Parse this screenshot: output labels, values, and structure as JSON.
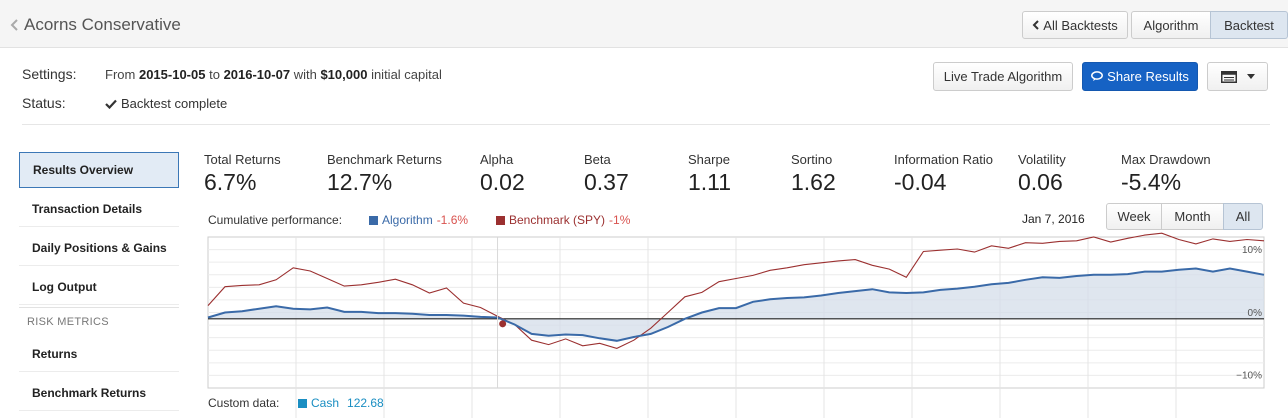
{
  "header": {
    "title": "Acorns Conservative",
    "all_backtests_label": "All Backtests",
    "tab_algorithm": "Algorithm",
    "tab_backtest": "Backtest"
  },
  "settings": {
    "settings_label": "Settings:",
    "from_word": "From",
    "start_date": "2015-10-05",
    "to_word": "to",
    "end_date": "2016-10-07",
    "with_word": "with",
    "capital": "$10,000",
    "capital_suffix": "initial capital",
    "status_label": "Status:",
    "status_value": "Backtest complete"
  },
  "actions": {
    "live_trade_label": "Live Trade Algorithm",
    "share_label": "Share Results"
  },
  "sidebar": {
    "items": [
      {
        "label": "Results Overview"
      },
      {
        "label": "Transaction Details"
      },
      {
        "label": "Daily Positions & Gains"
      },
      {
        "label": "Log Output"
      }
    ],
    "risk_header": "RISK METRICS",
    "risk_items": [
      {
        "label": "Returns"
      },
      {
        "label": "Benchmark Returns"
      }
    ]
  },
  "metrics": [
    {
      "label": "Total Returns",
      "value": "6.7%"
    },
    {
      "label": "Benchmark Returns",
      "value": "12.7%"
    },
    {
      "label": "Alpha",
      "value": "0.02"
    },
    {
      "label": "Beta",
      "value": "0.37"
    },
    {
      "label": "Sharpe",
      "value": "1.11"
    },
    {
      "label": "Sortino",
      "value": "1.62"
    },
    {
      "label": "Information Ratio",
      "value": "-0.04"
    },
    {
      "label": "Volatility",
      "value": "0.06"
    },
    {
      "label": "Max Drawdown",
      "value": "-5.4%"
    }
  ],
  "chart_header": {
    "cumulative_label": "Cumulative performance:",
    "algo_name": "Algorithm",
    "algo_value": "-1.6%",
    "bench_name": "Benchmark (SPY)",
    "bench_value": "-1%",
    "hover_date": "Jan 7, 2016",
    "range_week": "Week",
    "range_month": "Month",
    "range_all": "All"
  },
  "custom_data": {
    "label": "Custom data:",
    "series_name": "Cash",
    "series_value": "122.68"
  },
  "colors": {
    "algorithm": "#3a6aa8",
    "benchmark": "#9b3030",
    "cash": "#1a8ec2",
    "fill": "#d4dde9"
  },
  "chart_data": {
    "type": "line",
    "ylim": [
      -11,
      13
    ],
    "yticks": [
      {
        "value": 10,
        "label": "10%"
      },
      {
        "value": 0,
        "label": "0%"
      },
      {
        "value": -10,
        "label": "−10%"
      }
    ],
    "n_points": 63,
    "series": [
      {
        "name": "Algorithm",
        "values": [
          0.2,
          1.0,
          1.2,
          1.6,
          2.0,
          1.6,
          1.5,
          1.8,
          1.1,
          1.1,
          0.9,
          0.9,
          0.8,
          0.6,
          0.6,
          0.5,
          0.3,
          0.2,
          -0.9,
          -2.4,
          -2.7,
          -2.5,
          -2.6,
          -3.1,
          -3.5,
          -2.9,
          -2.4,
          -1.3,
          0.0,
          1.0,
          1.7,
          1.7,
          2.7,
          3.1,
          3.3,
          3.4,
          3.7,
          4.1,
          4.4,
          4.7,
          4.2,
          4.1,
          4.2,
          4.6,
          4.8,
          5.1,
          5.5,
          5.7,
          6.2,
          6.6,
          6.5,
          6.8,
          7.0,
          7.0,
          7.1,
          7.5,
          7.5,
          7.8,
          8.0,
          7.5,
          8.0,
          7.5,
          7.0
        ]
      },
      {
        "name": "Benchmark (SPY)",
        "values": [
          2.1,
          5.1,
          5.3,
          5.4,
          6.2,
          8.1,
          7.6,
          6.4,
          5.2,
          5.4,
          5.8,
          6.3,
          5.4,
          4.1,
          4.9,
          2.5,
          1.8,
          0.4,
          -0.9,
          -3.4,
          -4.1,
          -3.2,
          -4.3,
          -3.9,
          -4.7,
          -3.4,
          -1.5,
          1.0,
          3.5,
          4.2,
          5.9,
          6.4,
          6.9,
          7.7,
          8.1,
          8.6,
          8.9,
          9.2,
          9.4,
          8.5,
          7.9,
          6.6,
          10.7,
          10.9,
          11.1,
          10.6,
          11.6,
          11.2,
          12.1,
          12.0,
          12.3,
          12.4,
          13.0,
          12.2,
          12.8,
          13.3,
          13.6,
          12.6,
          11.9,
          12.7,
          12.3,
          12.6,
          12.4
        ]
      }
    ]
  }
}
